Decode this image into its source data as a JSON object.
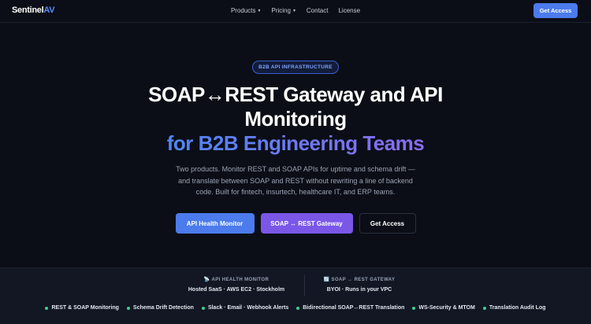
{
  "nav": {
    "logo_main": "Sentinel",
    "logo_accent": "AV",
    "links": [
      {
        "label": "Products",
        "has_caret": true
      },
      {
        "label": "Pricing",
        "has_caret": true
      },
      {
        "label": "Contact",
        "has_caret": false
      },
      {
        "label": "License",
        "has_caret": false
      }
    ],
    "cta_label": "Get Access"
  },
  "hero": {
    "badge": "B2B API INFRASTRUCTURE",
    "title_line1": "SOAP↔REST Gateway and API",
    "title_line2": "Monitoring",
    "title_line3": "for B2B Engineering Teams",
    "subtitle": "Two products. Monitor REST and SOAP APIs for uptime and schema drift — and translate between SOAP and REST without rewriting a line of backend code. Built for fintech, insurtech, healthcare IT, and ERP teams.",
    "buttons": {
      "primary": "API Health Monitor",
      "secondary": "SOAP ↔ REST Gateway",
      "tertiary": "Get Access"
    }
  },
  "products": {
    "monitor": {
      "icon": "📡",
      "label": "API HEALTH MONITOR",
      "desc": "Hosted SaaS · AWS EC2 · Stockholm"
    },
    "gateway": {
      "icon": "🔄",
      "label": "SOAP ↔ REST GATEWAY",
      "desc": "BYOI · Runs in your VPC"
    }
  },
  "features": [
    "REST & SOAP Monitoring",
    "Schema Drift Detection",
    "Slack · Email · Webhook Alerts",
    "Bidirectional SOAP↔REST Translation",
    "WS-Security & MTOM",
    "Translation Audit Log"
  ],
  "colors": {
    "background": "#0b0e16",
    "accent_blue": "#4b7bec",
    "accent_purple": "#7b57e8",
    "feature_dot": "#3ccf8e"
  }
}
